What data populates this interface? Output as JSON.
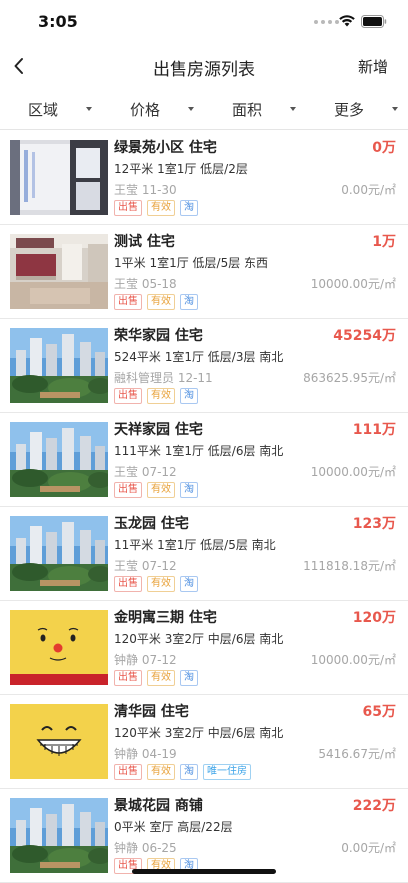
{
  "status_bar": {
    "time": "3:05"
  },
  "nav": {
    "title": "出售房源列表",
    "add_label": "新增"
  },
  "filters": [
    "区域",
    "价格",
    "面积",
    "更多"
  ],
  "listings": [
    {
      "title": "绿景苑小区 住宅",
      "price": "0万",
      "info": "12平米 1室1厅 低层/2层",
      "meta": "王莹 11-30",
      "unit_price": "0.00元/㎡",
      "image": "interior-window",
      "tags": [
        {
          "label": "出售",
          "type": "sale"
        },
        {
          "label": "有效",
          "type": "valid"
        },
        {
          "label": "淘",
          "type": "tao"
        }
      ]
    },
    {
      "title": "测试 住宅",
      "price": "1万",
      "info": "1平米 1室1厅 低层/5层 东西",
      "meta": "王莹 05-18",
      "unit_price": "10000.00元/㎡",
      "image": "interior-kitchen",
      "tags": [
        {
          "label": "出售",
          "type": "sale"
        },
        {
          "label": "有效",
          "type": "valid"
        },
        {
          "label": "淘",
          "type": "tao"
        }
      ]
    },
    {
      "title": "荣华家园 住宅",
      "price": "45254万",
      "info": "524平米 1室1厅 低层/3层 南北",
      "meta": "融科管理员 12-11",
      "unit_price": "863625.95元/㎡",
      "image": "buildings",
      "tags": [
        {
          "label": "出售",
          "type": "sale"
        },
        {
          "label": "有效",
          "type": "valid"
        },
        {
          "label": "淘",
          "type": "tao"
        }
      ]
    },
    {
      "title": "天祥家园 住宅",
      "price": "111万",
      "info": "111平米 1室1厅 低层/6层 南北",
      "meta": "王莹 07-12",
      "unit_price": "10000.00元/㎡",
      "image": "buildings",
      "tags": [
        {
          "label": "出售",
          "type": "sale"
        },
        {
          "label": "有效",
          "type": "valid"
        },
        {
          "label": "淘",
          "type": "tao"
        }
      ]
    },
    {
      "title": "玉龙园 住宅",
      "price": "123万",
      "info": "11平米 1室1厅 低层/5层 南北",
      "meta": "王莹 07-12",
      "unit_price": "111818.18元/㎡",
      "image": "buildings",
      "tags": [
        {
          "label": "出售",
          "type": "sale"
        },
        {
          "label": "有效",
          "type": "valid"
        },
        {
          "label": "淘",
          "type": "tao"
        }
      ]
    },
    {
      "title": "金明寓三期 住宅",
      "price": "120万",
      "info": "120平米 3室2厅 中层/6层 南北",
      "meta": "钟静 07-12",
      "unit_price": "10000.00元/㎡",
      "image": "cartoon-face",
      "tags": [
        {
          "label": "出售",
          "type": "sale"
        },
        {
          "label": "有效",
          "type": "valid"
        },
        {
          "label": "淘",
          "type": "tao"
        }
      ]
    },
    {
      "title": "清华园 住宅",
      "price": "65万",
      "info": "120平米 3室2厅 中层/6层 南北",
      "meta": "钟静 04-19",
      "unit_price": "5416.67元/㎡",
      "image": "grin-face",
      "tags": [
        {
          "label": "出售",
          "type": "sale"
        },
        {
          "label": "有效",
          "type": "valid"
        },
        {
          "label": "淘",
          "type": "tao"
        },
        {
          "label": "唯一住房",
          "type": "unique"
        }
      ]
    },
    {
      "title": "景城花园 商铺",
      "price": "222万",
      "info": "0平米 室厅 高层/22层",
      "meta": "钟静 06-25",
      "unit_price": "0.00元/㎡",
      "image": "buildings",
      "tags": [
        {
          "label": "出售",
          "type": "sale"
        },
        {
          "label": "有效",
          "type": "valid"
        },
        {
          "label": "淘",
          "type": "tao"
        }
      ]
    }
  ],
  "colors": {
    "price": "#e8584d",
    "accent_blue": "#4e8fe0",
    "valid_orange": "#e8a23a"
  }
}
